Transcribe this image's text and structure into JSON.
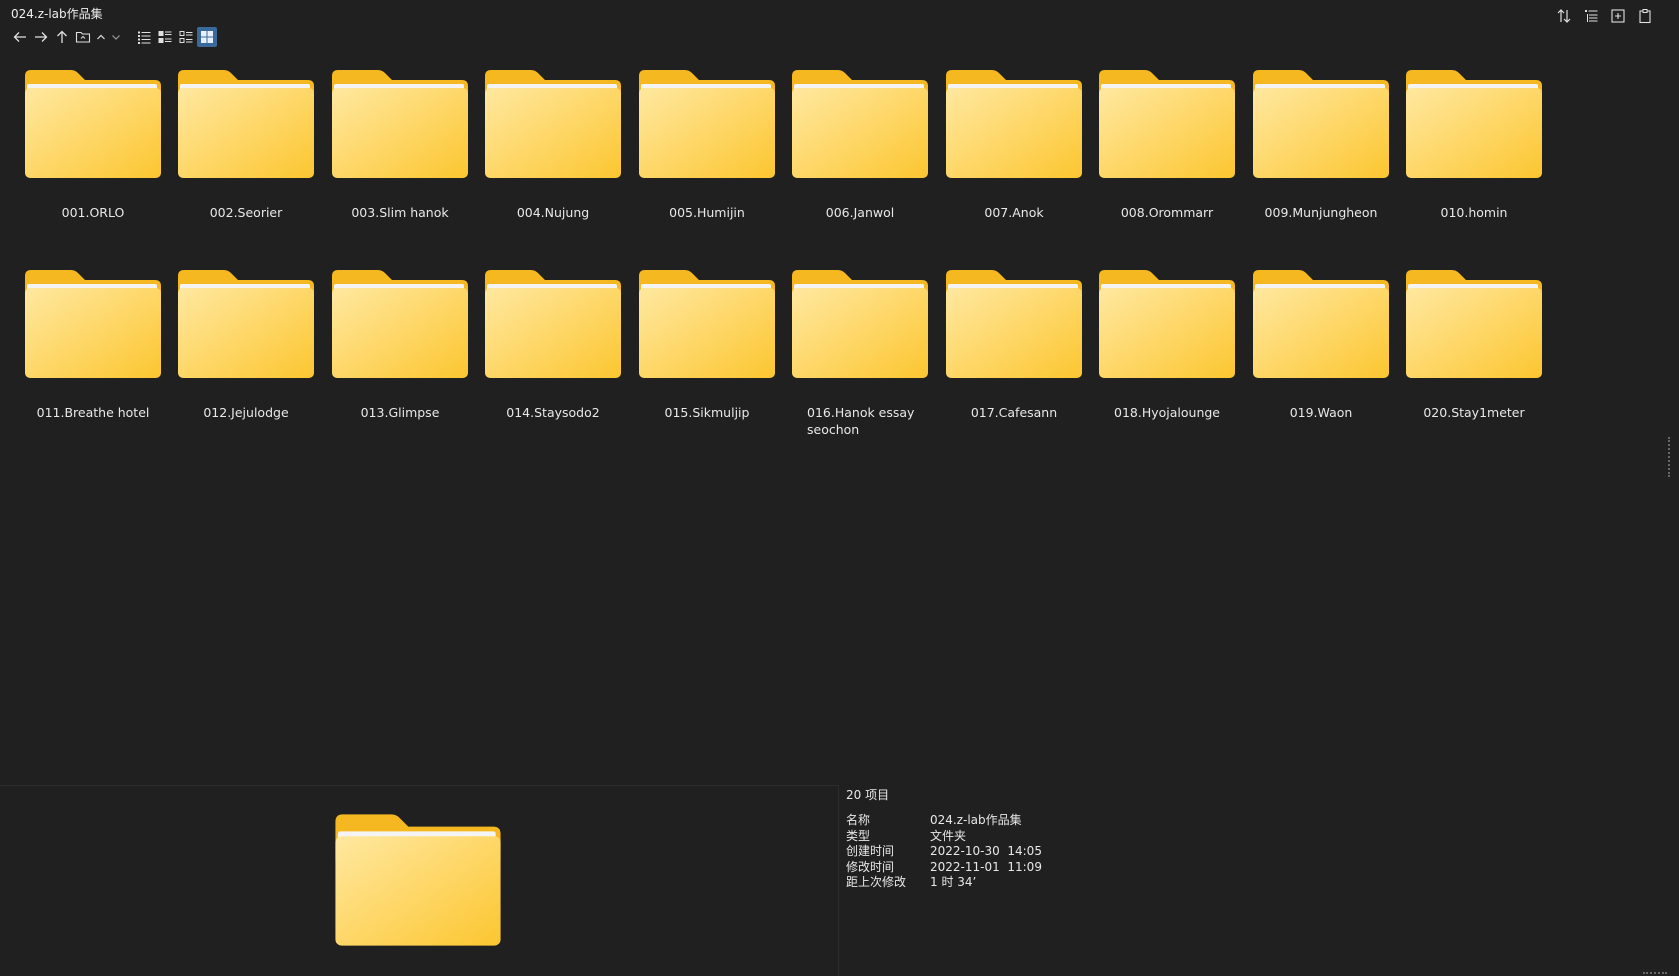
{
  "window": {
    "title": "024.z-lab作品集"
  },
  "toolbar": {
    "icons": [
      "back-arrow-icon",
      "forward-arrow-icon",
      "up-arrow-icon",
      "folder-icon",
      "chevron-up-icon",
      "chevron-down-icon",
      "list-view-icon",
      "details-view-icon",
      "tiles-view-icon",
      "large-icons-view-icon"
    ],
    "active_view": "large-icons-view-icon",
    "right_icons": [
      "sort-icon",
      "group-icon",
      "add-pane-icon",
      "clipboard-icon"
    ]
  },
  "folders": [
    {
      "name": "001.ORLO"
    },
    {
      "name": "002.Seorier"
    },
    {
      "name": "003.Slim hanok"
    },
    {
      "name": "004.Nujung"
    },
    {
      "name": "005.Humijin"
    },
    {
      "name": "006.Janwol"
    },
    {
      "name": "007.Anok"
    },
    {
      "name": "008.Orommarr"
    },
    {
      "name": "009.Munjungheon"
    },
    {
      "name": "010.homin"
    },
    {
      "name": "011.Breathe hotel"
    },
    {
      "name": "012.Jejulodge"
    },
    {
      "name": "013.Glimpse"
    },
    {
      "name": "014.Staysodo2"
    },
    {
      "name": "015.Sikmuljip"
    },
    {
      "name": "016.Hanok essay seochon"
    },
    {
      "name": "017.Cafesann"
    },
    {
      "name": "018.Hyojalounge"
    },
    {
      "name": "019.Waon"
    },
    {
      "name": "020.Stay1meter"
    }
  ],
  "details": {
    "count": "20 项目",
    "rows": [
      {
        "key": "名称",
        "value": "024.z-lab作品集"
      },
      {
        "key": "类型",
        "value": "文件夹"
      },
      {
        "key": "创建时间",
        "value": "2022-10-30  14:05"
      },
      {
        "key": "修改时间",
        "value": "2022-11-01  11:09"
      },
      {
        "key": "距上次修改",
        "value": "1 时 34’"
      }
    ]
  },
  "colors": {
    "background": "#202020",
    "folder_back": "#f5b920",
    "folder_front_light": "#ffe28a",
    "folder_front_dark": "#fcc937",
    "active_view_bg": "#3a6a9a"
  }
}
